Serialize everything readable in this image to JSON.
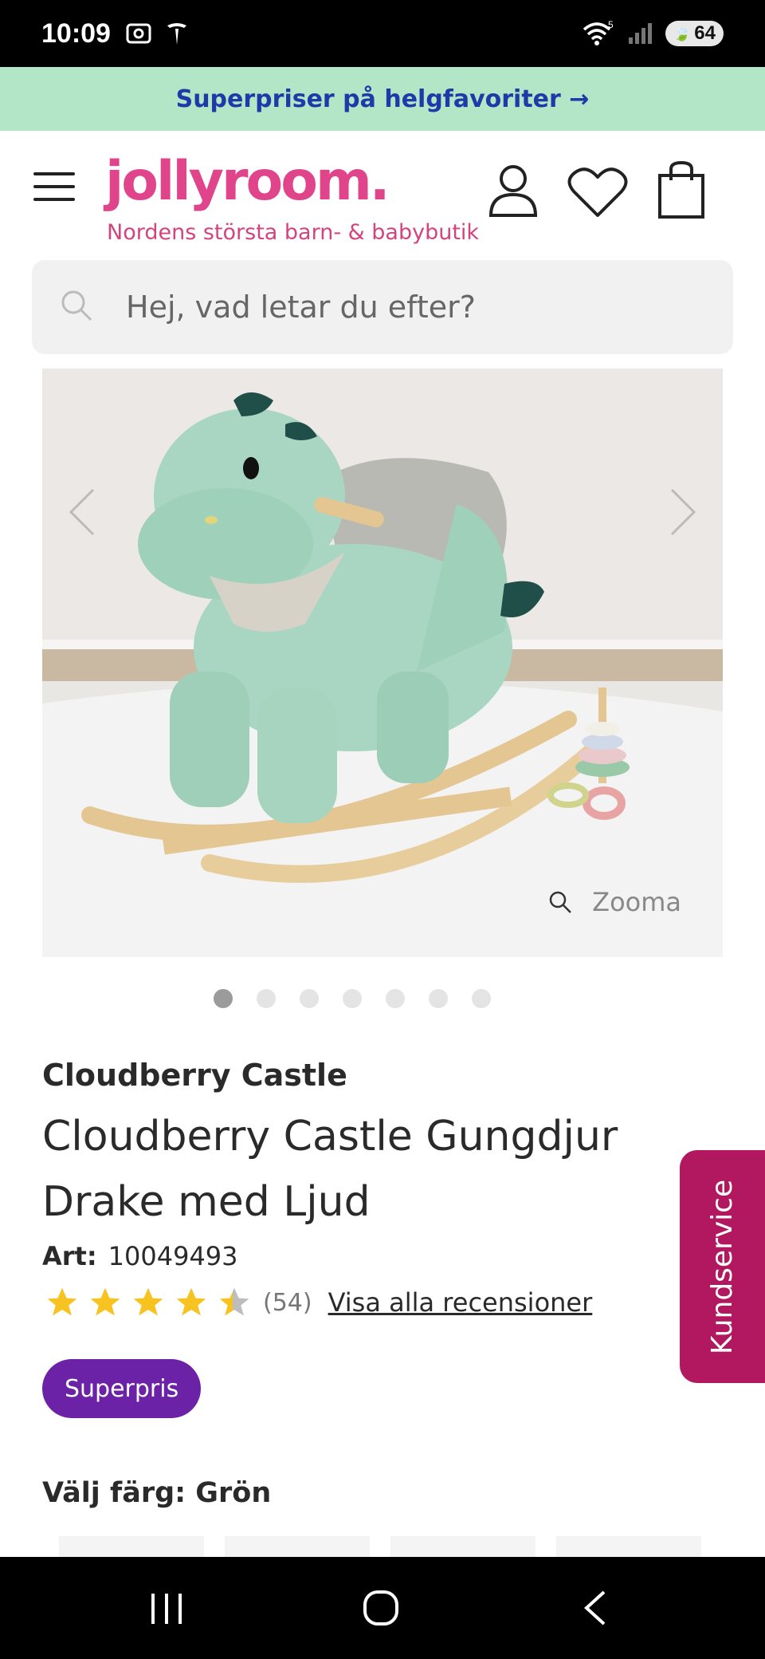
{
  "status_bar": {
    "time": "10:09",
    "battery": "64"
  },
  "promo": {
    "text": "Superpriser på helgfavoriter →"
  },
  "header": {
    "logo": "jollyroom.",
    "tagline": "Nordens största barn- & babybutik"
  },
  "search": {
    "placeholder": "Hej, vad letar du efter?"
  },
  "gallery": {
    "zoom_label": "Zooma",
    "image_count": 7,
    "active_index": 0
  },
  "product": {
    "brand": "Cloudberry Castle",
    "title": "Cloudberry Castle Gungdjur Drake med Ljud",
    "art_label": "Art:",
    "art_number": "10049493",
    "rating": 4,
    "rating_max": 5,
    "review_count": "(54)",
    "reviews_link": "Visa alla recensioner",
    "badge": "Superpris",
    "color_label": "Välj färg: Grön"
  },
  "side_tab": {
    "label": "Kundservice"
  },
  "colors": {
    "brand_pink": "#e0458b",
    "promo_bg": "#b3e6c6",
    "promo_text": "#1d3aa8",
    "badge_purple": "#6b22a6",
    "kundservice_bg": "#b2185f",
    "star_yellow": "#f7c321"
  }
}
